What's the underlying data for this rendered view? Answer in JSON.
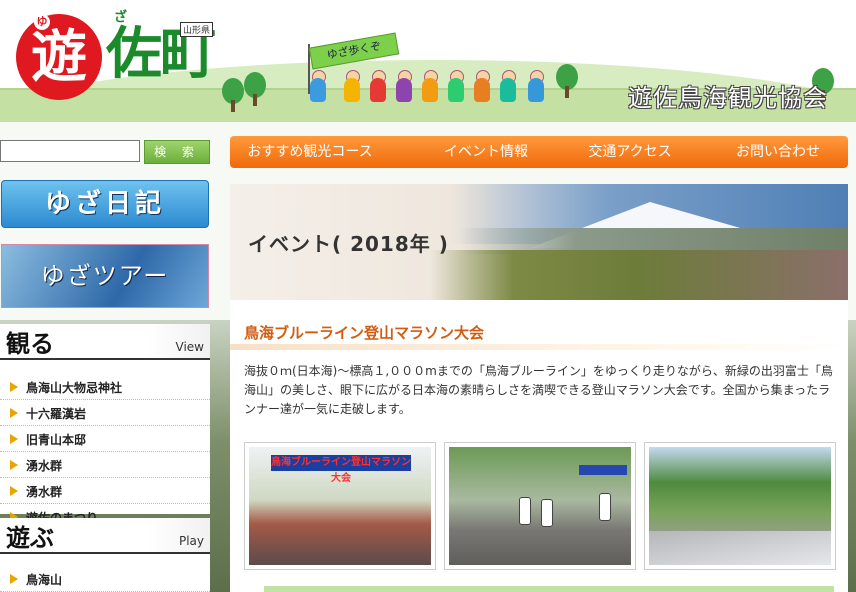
{
  "header": {
    "logo_main": "遊",
    "logo_ruby_yu": "ゆ",
    "logo_sub": "佐町",
    "logo_ruby_za": "ざ",
    "prefecture_badge": "山形県",
    "flag_text": "ゆざ歩くぞ",
    "org_name": "遊佐鳥海観光協会"
  },
  "search": {
    "value": "",
    "placeholder": "",
    "button_label": "検 索"
  },
  "sidebar": {
    "diary_label": "ゆざ日記",
    "tour_label": "ゆざツアー",
    "categories": [
      {
        "title": "観る",
        "title_en": "View",
        "items": [
          "鳥海山大物忌神社",
          "十六羅漢岩",
          "旧青山本邸",
          "湧水群",
          "湧水群",
          "遊佐のまつり"
        ]
      },
      {
        "title": "遊ぶ",
        "title_en": "Play",
        "items": [
          "鳥海山"
        ]
      }
    ]
  },
  "nav": {
    "items": [
      "おすすめ観光コース",
      "イベント情報",
      "交通アクセス",
      "お問い合わせ"
    ]
  },
  "main": {
    "hero_title": "イベント( 2018年 )",
    "section_title": "鳥海ブルーライン登山マラソン大会",
    "description": "海抜０ｍ(日本海)～標高１,０００mまでの「鳥海ブルーライン」をゆっくり走りながら、新緑の出羽富士「鳥海山」の美しさ、眼下に広がる日本海の素晴らしさを満喫できる登山マラソン大会です。全国から集まったランナー達が一気に走破します。",
    "photo1_banner": "鳥海ブルーライン登山マラソン大会"
  },
  "colors": {
    "nav_orange": "#ef6a0a",
    "section_title": "#d25c10",
    "logo_red": "#e01820",
    "logo_green": "#1a8a2a",
    "search_green": "#6cae3b"
  }
}
